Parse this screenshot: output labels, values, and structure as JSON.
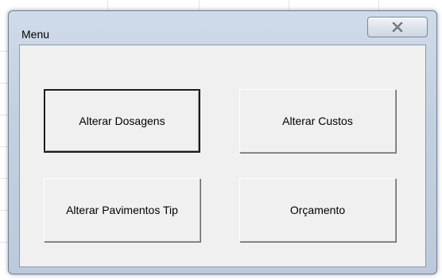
{
  "window": {
    "title": "Menu",
    "close_icon": "close-icon"
  },
  "buttons": {
    "alterar_dosagens": "Alterar Dosagens",
    "alterar_custos": "Alterar Custos",
    "alterar_pavimentos": "Alterar Pavimentos Tip",
    "orcamento": "Orçamento"
  },
  "colors": {
    "frame": "#c3d0e0",
    "client_background": "#f0f0f0",
    "button_text": "#000000"
  }
}
